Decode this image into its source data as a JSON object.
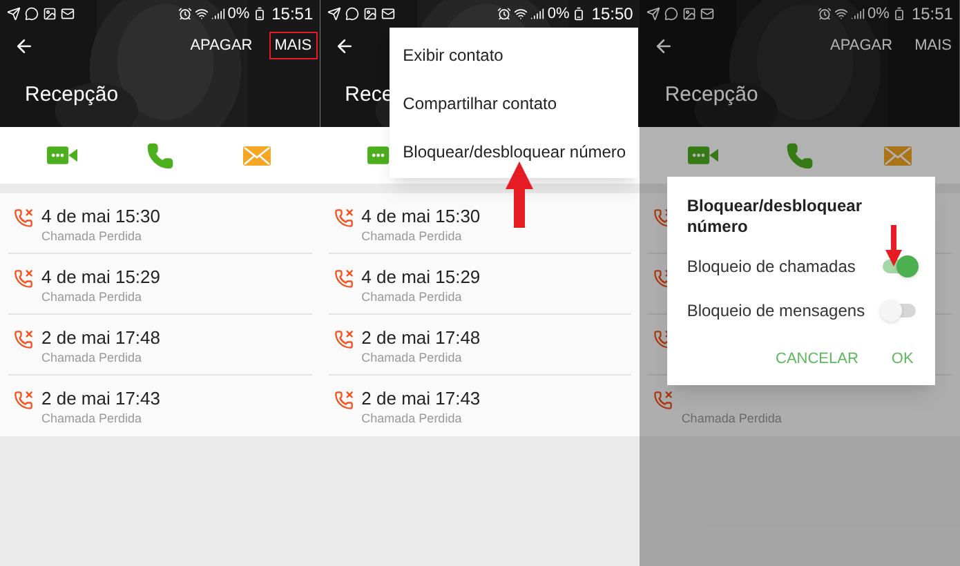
{
  "panels": [
    {
      "status_bar": {
        "battery": "0%",
        "time": "15:51"
      },
      "actions": [
        {
          "label": "APAGAR",
          "highlighted": false
        },
        {
          "label": "MAIS",
          "highlighted": true
        }
      ],
      "title": "Recepção",
      "contact_actions": [
        {
          "kind": "video"
        },
        {
          "kind": "phone"
        },
        {
          "kind": "message"
        }
      ],
      "rows": [
        {
          "date": "4 de mai 15:30",
          "subtitle": "Chamada Perdida"
        },
        {
          "date": "4 de mai 15:29",
          "subtitle": "Chamada Perdida"
        },
        {
          "date": "2 de mai 17:48",
          "subtitle": "Chamada Perdida"
        },
        {
          "date": "2 de mai 17:43",
          "subtitle": "Chamada Perdida"
        }
      ]
    },
    {
      "status_bar": {
        "battery": "0%",
        "time": "15:50"
      },
      "title": "Rece",
      "contact_actions": [
        {
          "kind": "video"
        }
      ],
      "rows": [
        {
          "date": "4 de mai 15:30",
          "subtitle": "Chamada Perdida"
        },
        {
          "date": "4 de mai 15:29",
          "subtitle": "Chamada Perdida"
        },
        {
          "date": "2 de mai 17:48",
          "subtitle": "Chamada Perdida"
        },
        {
          "date": "2 de mai 17:43",
          "subtitle": "Chamada Perdida"
        }
      ],
      "menu": {
        "items": [
          "Exibir contato",
          "Compartilhar contato",
          "Bloquear/desbloquear número"
        ]
      },
      "arrow": {
        "kind": "up"
      }
    },
    {
      "status_bar": {
        "battery": "0%",
        "time": "15:51"
      },
      "actions": [
        {
          "label": "APAGAR",
          "highlighted": false
        },
        {
          "label": "MAIS",
          "highlighted": false
        }
      ],
      "title": "Recepção",
      "contact_actions": [
        {
          "kind": "video"
        },
        {
          "kind": "phone"
        },
        {
          "kind": "message"
        }
      ],
      "rows": [
        {},
        {},
        {},
        {
          "subtitle": "Chamada Perdida"
        }
      ],
      "dialog": {
        "title": "Bloquear/desbloquear número",
        "switches": [
          {
            "label": "Bloqueio de chamadas",
            "on": true
          },
          {
            "label": "Bloqueio de mensagens",
            "on": false
          }
        ],
        "buttons": [
          "CANCELAR",
          "OK"
        ]
      },
      "arrow": {
        "kind": "down"
      }
    }
  ]
}
